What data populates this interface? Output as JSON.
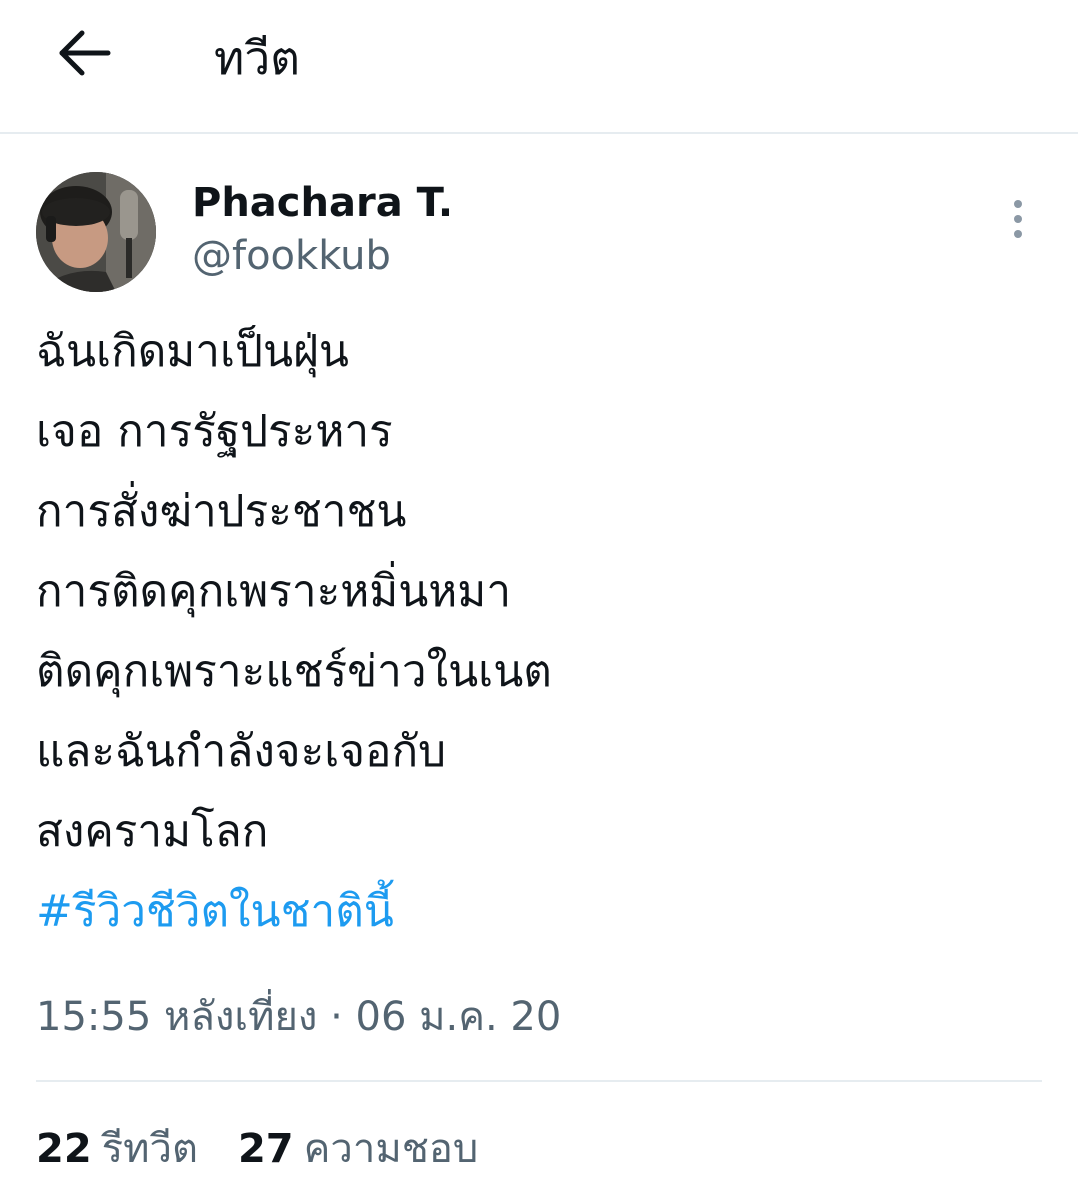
{
  "header": {
    "title": "ทวีต",
    "back_icon": "arrow-left-icon"
  },
  "tweet": {
    "author": {
      "display_name": "Phachara T.",
      "username": "@fookkub",
      "avatar_icon": "avatar-photo"
    },
    "more_icon": "more-vertical-icon",
    "lines": [
      "ฉันเกิดมาเป็นฝุ่น",
      "เจอ การรัฐประหาร",
      "การสั่งฆ่าประชาชน",
      "การติดคุกเพราะหมิ่นหมา",
      "ติดคุกเพราะแชร์ข่าวในเนต",
      "และฉันกำลังจะเจอกับ",
      "สงครามโลก"
    ],
    "hashtag": "#รีวิวชีวิตในชาตินี้",
    "timestamp": "15:55 หลังเที่ยง · 06 ม.ค. 20",
    "stats": {
      "retweets_count": "22",
      "retweets_label": "รีทวีต",
      "likes_count": "27",
      "likes_label": "ความชอบ"
    }
  },
  "colors": {
    "text": "#0f1419",
    "secondary_text": "#536471",
    "link": "#1d9bf0",
    "divider": "#e6ecf0"
  }
}
